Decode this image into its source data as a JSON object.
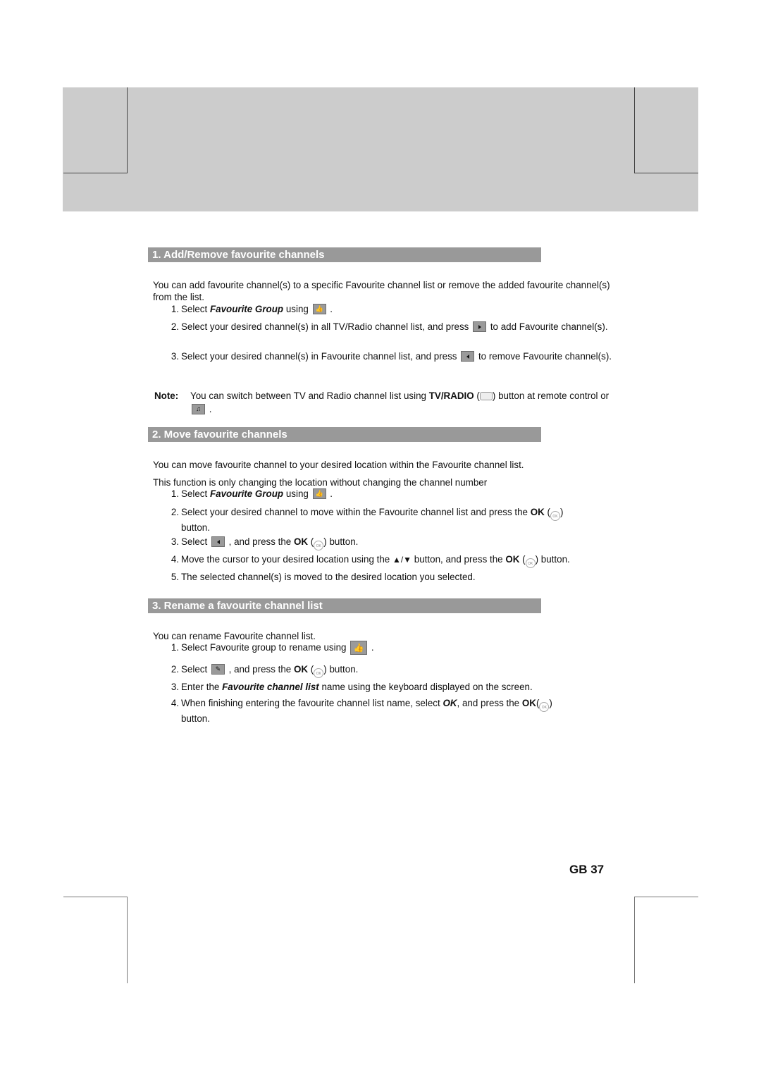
{
  "sections": [
    {
      "title": "1. Add/Remove favourite channels",
      "intro": "You can add favourite channel(s) to a specific Favourite channel list or remove the added favourite channel(s) from the list.",
      "steps": [
        {
          "num": "1.",
          "pre": "Select ",
          "em": "Favourite Group",
          "mid": " using ",
          "icon": "favourite-group-icon",
          "post": " ."
        },
        {
          "num": "2.",
          "pre": "Select your desired channel(s) in all TV/Radio channel list, and press ",
          "icon": "add-right-arrow-icon",
          "post": " to add Favourite channel(s)."
        },
        {
          "num": "3.",
          "pre": "Select your desired channel(s) in Favourite channel list, and press ",
          "icon": "remove-left-arrow-icon",
          "post": " to remove Favourite channel(s)."
        }
      ],
      "note": {
        "label": "Note:",
        "pre": "You can switch between TV and Radio channel list using ",
        "bold": "TV/RADIO",
        "mid": " button at remote control or ",
        "icon": "radio-music-icon",
        "post": " ."
      }
    },
    {
      "title": "2. Move favourite channels",
      "intro1": "You can move favourite channel to your desired location within the Favourite channel list.",
      "intro2": "This function is only changing the location without changing the channel number",
      "steps": [
        {
          "num": "1.",
          "pre": "Select ",
          "em": "Favourite Group",
          "mid": " using ",
          "post": " ."
        },
        {
          "num": "2.",
          "pre": "Select your desired channel to move within the Favourite channel list and press the ",
          "bold": "OK",
          "post": " button."
        },
        {
          "num": "3.",
          "pre": "Select ",
          "mid": " , and press the ",
          "bold": "OK",
          "post": " button."
        },
        {
          "num": "4.",
          "pre": "Move the cursor to your desired location using the ",
          "arrows": "▲/▼",
          "mid": " button, and press the ",
          "bold": "OK",
          "post": " button."
        },
        {
          "num": "5.",
          "pre": "The selected channel(s) is moved to the desired location you selected."
        }
      ]
    },
    {
      "title": "3. Rename a favourite channel list",
      "intro": "You can rename Favourite channel list.",
      "steps": [
        {
          "num": "1.",
          "pre": "Select Favourite group to rename using ",
          "post": " ."
        },
        {
          "num": "2.",
          "pre": "Select ",
          "mid": " , and press the ",
          "bold": "OK",
          "post": " button."
        },
        {
          "num": "3.",
          "pre": "Enter the ",
          "em": "Favourite channel list",
          "post": " name using the keyboard displayed on the screen."
        },
        {
          "num": "4.",
          "pre": "When finishing entering the favourite channel list name, select ",
          "em": "OK",
          "mid": ", and press the ",
          "bold": "OK",
          "post": " button."
        }
      ]
    }
  ],
  "icons": {
    "favourite_glyph": "👍",
    "music_glyph": "♫",
    "rename_glyph": "✎",
    "ok_glyph": "OK"
  },
  "footer": {
    "page_number": "GB 37"
  }
}
